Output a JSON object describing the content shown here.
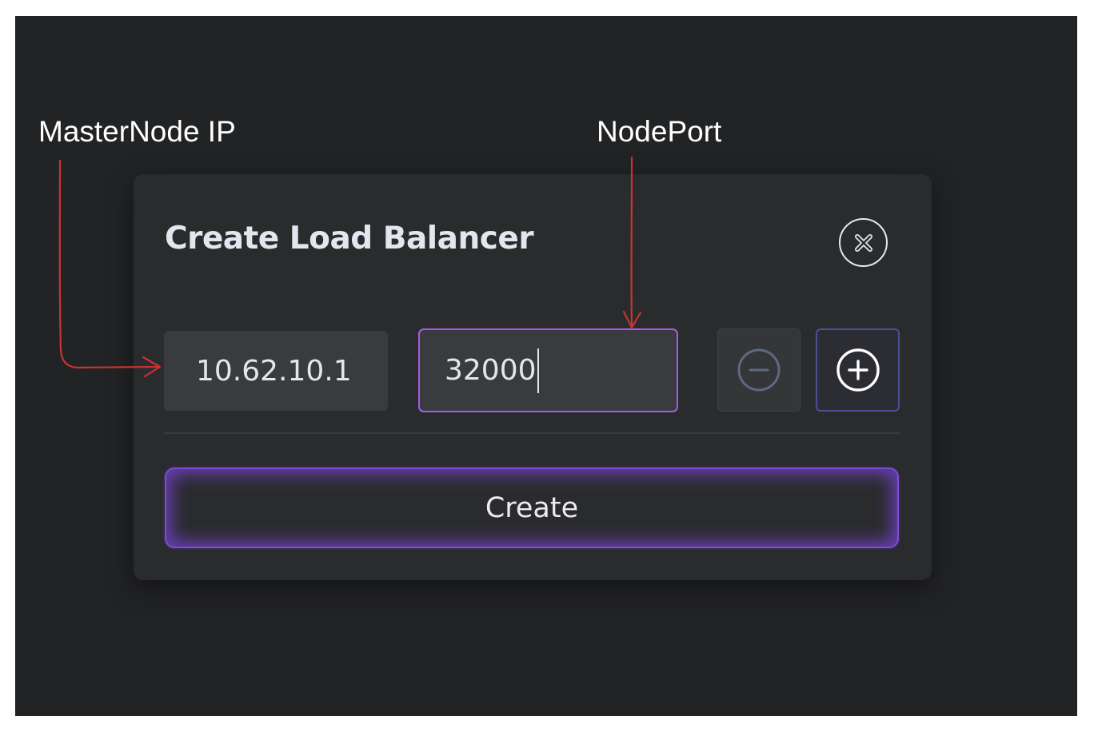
{
  "annotations": {
    "master_node_ip_label": "MasterNode IP",
    "node_port_label": "NodePort",
    "arrow_color": "#c9352e"
  },
  "dialog": {
    "title": "Create Load Balancer",
    "close_icon": "close-circle-icon",
    "ip_input": {
      "value": "10.62.10.1"
    },
    "port_input": {
      "value": "32000",
      "focused": true
    },
    "remove_button": {
      "icon": "minus-circle-icon",
      "disabled": true
    },
    "add_button": {
      "icon": "plus-circle-icon"
    },
    "create_button": {
      "label": "Create"
    }
  },
  "colors": {
    "background": "#222325",
    "dialog_background": "#2a2b2d",
    "input_background": "#3a3b3e",
    "focus_border": "#a45ce4",
    "create_glow": "#7a4fd8",
    "plus_border": "#4b4f9a"
  }
}
